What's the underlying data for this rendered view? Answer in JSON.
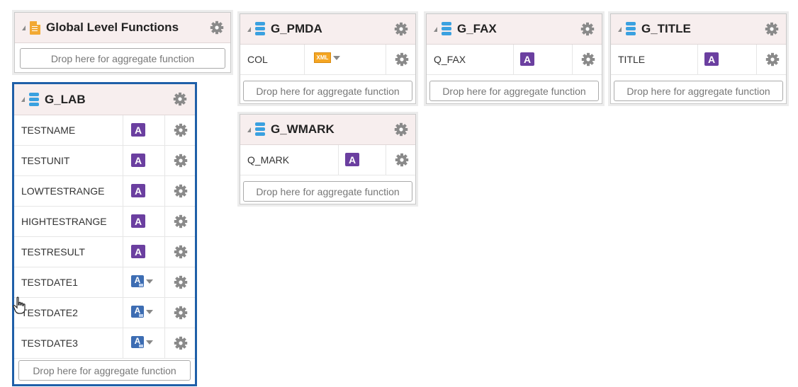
{
  "colors": {
    "accent": "#1f5fa8",
    "attribute_badge": "#6b3fa0",
    "date_badge": "#3d6db3",
    "header_bg": "#f7eeee",
    "db_icon": "#3aa1e0",
    "doc_icon": "#f2a933",
    "xml_badge": "#f5a623"
  },
  "global": {
    "title": "Global Level Functions",
    "icon": "document-icon",
    "drop_label": "Drop here for aggregate function"
  },
  "g_lab": {
    "title": "G_LAB",
    "icon": "database-icon",
    "drop_label": "Drop here for aggregate function",
    "fields": [
      {
        "name": "TESTNAME",
        "type": "attribute",
        "badge": "A"
      },
      {
        "name": "TESTUNIT",
        "type": "attribute",
        "badge": "A"
      },
      {
        "name": "LOWTESTRANGE",
        "type": "attribute",
        "badge": "A"
      },
      {
        "name": "HIGHTESTRANGE",
        "type": "attribute",
        "badge": "A"
      },
      {
        "name": "TESTRESULT",
        "type": "attribute",
        "badge": "A"
      },
      {
        "name": "TESTDATE1",
        "type": "date-dropdown",
        "badge": "A"
      },
      {
        "name": "TESTDATE2",
        "type": "date-dropdown",
        "badge": "A"
      },
      {
        "name": "TESTDATE3",
        "type": "date-dropdown",
        "badge": "A"
      }
    ]
  },
  "g_pmda": {
    "title": "G_PMDA",
    "icon": "database-icon",
    "drop_label": "Drop here for aggregate function",
    "fields": [
      {
        "name": "COL",
        "type": "xml-dropdown",
        "badge": "XML"
      }
    ]
  },
  "g_wmark": {
    "title": "G_WMARK",
    "icon": "database-icon",
    "drop_label": "Drop here for aggregate function",
    "fields": [
      {
        "name": "Q_MARK",
        "type": "attribute",
        "badge": "A"
      }
    ]
  },
  "g_fax": {
    "title": "G_FAX",
    "icon": "database-icon",
    "drop_label": "Drop here for aggregate function",
    "fields": [
      {
        "name": "Q_FAX",
        "type": "attribute",
        "badge": "A"
      }
    ]
  },
  "g_title": {
    "title": "G_TITLE",
    "icon": "database-icon",
    "drop_label": "Drop here for aggregate function",
    "fields": [
      {
        "name": "TITLE",
        "type": "attribute",
        "badge": "A"
      }
    ]
  }
}
